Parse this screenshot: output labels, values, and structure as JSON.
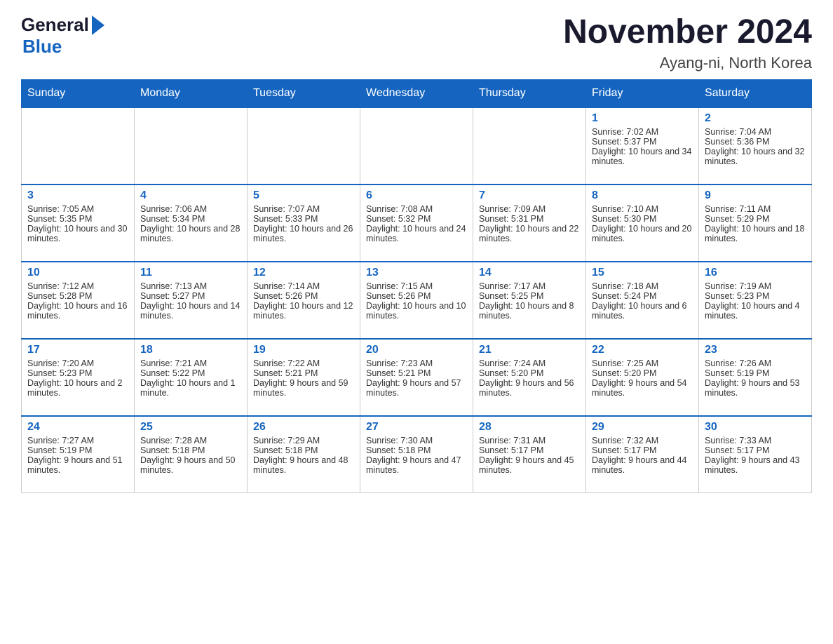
{
  "header": {
    "month_title": "November 2024",
    "location": "Ayang-ni, North Korea",
    "logo_general": "General",
    "logo_blue": "Blue"
  },
  "days_of_week": [
    "Sunday",
    "Monday",
    "Tuesday",
    "Wednesday",
    "Thursday",
    "Friday",
    "Saturday"
  ],
  "weeks": [
    {
      "days": [
        {
          "num": "",
          "sunrise": "",
          "sunset": "",
          "daylight": ""
        },
        {
          "num": "",
          "sunrise": "",
          "sunset": "",
          "daylight": ""
        },
        {
          "num": "",
          "sunrise": "",
          "sunset": "",
          "daylight": ""
        },
        {
          "num": "",
          "sunrise": "",
          "sunset": "",
          "daylight": ""
        },
        {
          "num": "",
          "sunrise": "",
          "sunset": "",
          "daylight": ""
        },
        {
          "num": "1",
          "sunrise": "Sunrise: 7:02 AM",
          "sunset": "Sunset: 5:37 PM",
          "daylight": "Daylight: 10 hours and 34 minutes."
        },
        {
          "num": "2",
          "sunrise": "Sunrise: 7:04 AM",
          "sunset": "Sunset: 5:36 PM",
          "daylight": "Daylight: 10 hours and 32 minutes."
        }
      ]
    },
    {
      "days": [
        {
          "num": "3",
          "sunrise": "Sunrise: 7:05 AM",
          "sunset": "Sunset: 5:35 PM",
          "daylight": "Daylight: 10 hours and 30 minutes."
        },
        {
          "num": "4",
          "sunrise": "Sunrise: 7:06 AM",
          "sunset": "Sunset: 5:34 PM",
          "daylight": "Daylight: 10 hours and 28 minutes."
        },
        {
          "num": "5",
          "sunrise": "Sunrise: 7:07 AM",
          "sunset": "Sunset: 5:33 PM",
          "daylight": "Daylight: 10 hours and 26 minutes."
        },
        {
          "num": "6",
          "sunrise": "Sunrise: 7:08 AM",
          "sunset": "Sunset: 5:32 PM",
          "daylight": "Daylight: 10 hours and 24 minutes."
        },
        {
          "num": "7",
          "sunrise": "Sunrise: 7:09 AM",
          "sunset": "Sunset: 5:31 PM",
          "daylight": "Daylight: 10 hours and 22 minutes."
        },
        {
          "num": "8",
          "sunrise": "Sunrise: 7:10 AM",
          "sunset": "Sunset: 5:30 PM",
          "daylight": "Daylight: 10 hours and 20 minutes."
        },
        {
          "num": "9",
          "sunrise": "Sunrise: 7:11 AM",
          "sunset": "Sunset: 5:29 PM",
          "daylight": "Daylight: 10 hours and 18 minutes."
        }
      ]
    },
    {
      "days": [
        {
          "num": "10",
          "sunrise": "Sunrise: 7:12 AM",
          "sunset": "Sunset: 5:28 PM",
          "daylight": "Daylight: 10 hours and 16 minutes."
        },
        {
          "num": "11",
          "sunrise": "Sunrise: 7:13 AM",
          "sunset": "Sunset: 5:27 PM",
          "daylight": "Daylight: 10 hours and 14 minutes."
        },
        {
          "num": "12",
          "sunrise": "Sunrise: 7:14 AM",
          "sunset": "Sunset: 5:26 PM",
          "daylight": "Daylight: 10 hours and 12 minutes."
        },
        {
          "num": "13",
          "sunrise": "Sunrise: 7:15 AM",
          "sunset": "Sunset: 5:26 PM",
          "daylight": "Daylight: 10 hours and 10 minutes."
        },
        {
          "num": "14",
          "sunrise": "Sunrise: 7:17 AM",
          "sunset": "Sunset: 5:25 PM",
          "daylight": "Daylight: 10 hours and 8 minutes."
        },
        {
          "num": "15",
          "sunrise": "Sunrise: 7:18 AM",
          "sunset": "Sunset: 5:24 PM",
          "daylight": "Daylight: 10 hours and 6 minutes."
        },
        {
          "num": "16",
          "sunrise": "Sunrise: 7:19 AM",
          "sunset": "Sunset: 5:23 PM",
          "daylight": "Daylight: 10 hours and 4 minutes."
        }
      ]
    },
    {
      "days": [
        {
          "num": "17",
          "sunrise": "Sunrise: 7:20 AM",
          "sunset": "Sunset: 5:23 PM",
          "daylight": "Daylight: 10 hours and 2 minutes."
        },
        {
          "num": "18",
          "sunrise": "Sunrise: 7:21 AM",
          "sunset": "Sunset: 5:22 PM",
          "daylight": "Daylight: 10 hours and 1 minute."
        },
        {
          "num": "19",
          "sunrise": "Sunrise: 7:22 AM",
          "sunset": "Sunset: 5:21 PM",
          "daylight": "Daylight: 9 hours and 59 minutes."
        },
        {
          "num": "20",
          "sunrise": "Sunrise: 7:23 AM",
          "sunset": "Sunset: 5:21 PM",
          "daylight": "Daylight: 9 hours and 57 minutes."
        },
        {
          "num": "21",
          "sunrise": "Sunrise: 7:24 AM",
          "sunset": "Sunset: 5:20 PM",
          "daylight": "Daylight: 9 hours and 56 minutes."
        },
        {
          "num": "22",
          "sunrise": "Sunrise: 7:25 AM",
          "sunset": "Sunset: 5:20 PM",
          "daylight": "Daylight: 9 hours and 54 minutes."
        },
        {
          "num": "23",
          "sunrise": "Sunrise: 7:26 AM",
          "sunset": "Sunset: 5:19 PM",
          "daylight": "Daylight: 9 hours and 53 minutes."
        }
      ]
    },
    {
      "days": [
        {
          "num": "24",
          "sunrise": "Sunrise: 7:27 AM",
          "sunset": "Sunset: 5:19 PM",
          "daylight": "Daylight: 9 hours and 51 minutes."
        },
        {
          "num": "25",
          "sunrise": "Sunrise: 7:28 AM",
          "sunset": "Sunset: 5:18 PM",
          "daylight": "Daylight: 9 hours and 50 minutes."
        },
        {
          "num": "26",
          "sunrise": "Sunrise: 7:29 AM",
          "sunset": "Sunset: 5:18 PM",
          "daylight": "Daylight: 9 hours and 48 minutes."
        },
        {
          "num": "27",
          "sunrise": "Sunrise: 7:30 AM",
          "sunset": "Sunset: 5:18 PM",
          "daylight": "Daylight: 9 hours and 47 minutes."
        },
        {
          "num": "28",
          "sunrise": "Sunrise: 7:31 AM",
          "sunset": "Sunset: 5:17 PM",
          "daylight": "Daylight: 9 hours and 45 minutes."
        },
        {
          "num": "29",
          "sunrise": "Sunrise: 7:32 AM",
          "sunset": "Sunset: 5:17 PM",
          "daylight": "Daylight: 9 hours and 44 minutes."
        },
        {
          "num": "30",
          "sunrise": "Sunrise: 7:33 AM",
          "sunset": "Sunset: 5:17 PM",
          "daylight": "Daylight: 9 hours and 43 minutes."
        }
      ]
    }
  ]
}
